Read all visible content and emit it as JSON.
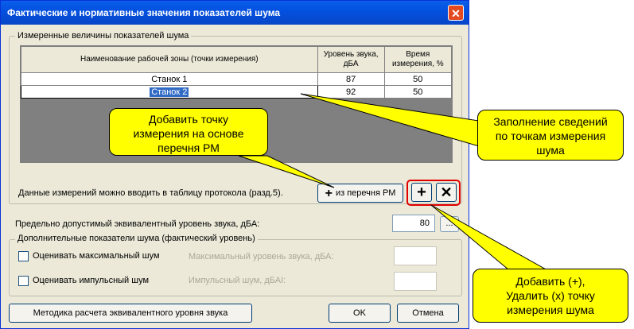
{
  "dialog": {
    "title": "Фактические и нормативные значения показателей шума",
    "close_label": "✕"
  },
  "measured_group": {
    "label": "Измеренные величины показателей шума",
    "table": {
      "headers": [
        "Наименование рабочей зоны (точки измерения)",
        "Уровень звука, дБА",
        "Время измерения, %"
      ],
      "rows": [
        {
          "name": "Станок 1",
          "level": "87",
          "time": "50"
        },
        {
          "name": "Станок 2",
          "level": "92",
          "time": "50"
        }
      ]
    },
    "note": "Данные измерений можно вводить в таблицу протокола (разд.5).",
    "from_list_button": "из перечня РМ",
    "plus_icon": "+",
    "add_button_label": "+",
    "delete_button_label": "✕"
  },
  "limit": {
    "label": "Предельно допустимый эквивалентный уровень звука, дБА:",
    "value": "80",
    "browse_label": "..."
  },
  "extra_group": {
    "label": "Дополнительные показатели шума (фактический уровень)",
    "max_checkbox_label": "Оценивать максимальный шум",
    "max_field_label": "Максимальный уровень звука, дБА:",
    "impulse_checkbox_label": "Оценивать импульсный шум",
    "impulse_field_label": "Импульсный шум, дБАI:"
  },
  "footer": {
    "method_button": "Методика расчета эквивалентного уровня звука",
    "ok_button": "OK",
    "cancel_button": "Отмена"
  },
  "callouts": {
    "add_point": [
      "Добавить точку",
      "измерения на основе",
      "перечня РМ"
    ],
    "fill_info": [
      "Заполнение сведений",
      "по точкам измерения",
      "шума"
    ],
    "add_delete": [
      "Добавить (+),",
      "Удалить (х) точку",
      "измерения шума"
    ]
  },
  "colors": {
    "title_bar": "#0451e0",
    "selection": "#316ac5",
    "callout": "#ffff00",
    "highlight_border": "#e00000"
  }
}
